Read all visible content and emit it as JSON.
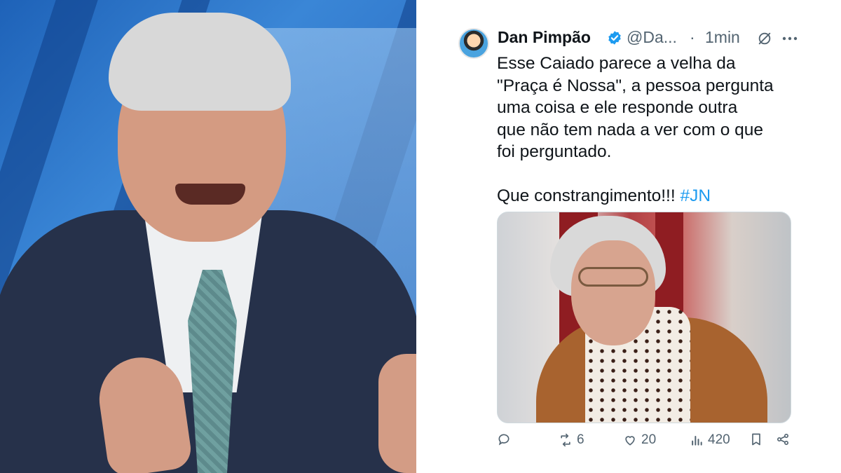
{
  "tweet": {
    "author_name": "Dan Pimpão",
    "handle": "@Da...",
    "separator": "·",
    "time": "1min",
    "lines": [
      "Esse Caiado parece a velha da",
      "\"Praça é Nossa\", a pessoa pergunta",
      "uma coisa e ele responde outra",
      "que não tem nada a ver com o que",
      "foi perguntado."
    ],
    "last_line_text": "Que constrangimento!!! ",
    "hashtag": "#JN",
    "actions": {
      "replies": "",
      "retweets": "6",
      "likes": "20",
      "views": "420"
    },
    "icons": [
      "verified-badge-icon",
      "grok-icon",
      "more-icon",
      "reply-icon",
      "retweet-icon",
      "like-icon",
      "views-icon",
      "bookmark-icon",
      "share-icon"
    ],
    "colors": {
      "accent": "#1d9bf0",
      "text": "#0f1419",
      "secondary": "#536471"
    }
  }
}
